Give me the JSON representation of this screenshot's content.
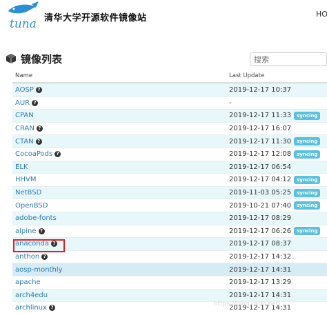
{
  "header": {
    "site_title": "清华大学开源软件镜像站",
    "right_text": "HOM"
  },
  "section": {
    "title": "镜像列表",
    "icon": "cube-icon"
  },
  "search": {
    "placeholder": "搜索"
  },
  "table": {
    "columns": [
      "Name",
      "Last Update"
    ],
    "rows": [
      {
        "name": "AOSP",
        "help": true,
        "date": "2019-12-17 10:37",
        "status": ""
      },
      {
        "name": "AUR",
        "help": true,
        "date": "-",
        "status": ""
      },
      {
        "name": "CPAN",
        "help": false,
        "date": "2019-12-17 11:33",
        "status": "syncing"
      },
      {
        "name": "CRAN",
        "help": true,
        "date": "2019-12-17 16:07",
        "status": ""
      },
      {
        "name": "CTAN",
        "help": true,
        "date": "2019-12-17 11:30",
        "status": "syncing"
      },
      {
        "name": "CocoaPods",
        "help": true,
        "date": "2019-12-17 12:08",
        "status": "syncing"
      },
      {
        "name": "ELK",
        "help": false,
        "date": "2019-12-17 06:54",
        "status": ""
      },
      {
        "name": "HHVM",
        "help": false,
        "date": "2019-12-17 04:12",
        "status": "syncing"
      },
      {
        "name": "NetBSD",
        "help": false,
        "date": "2019-11-03 05:25",
        "status": "syncing"
      },
      {
        "name": "OpenBSD",
        "help": false,
        "date": "2019-10-21 07:40",
        "status": "syncing"
      },
      {
        "name": "adobe-fonts",
        "help": false,
        "date": "2019-12-17 08:29",
        "status": ""
      },
      {
        "name": "alpine",
        "help": true,
        "date": "2019-12-17 06:26",
        "status": "syncing"
      },
      {
        "name": "anaconda",
        "help": true,
        "date": "2019-12-17 08:37",
        "status": ""
      },
      {
        "name": "anthon",
        "help": true,
        "date": "2019-12-17 14:32",
        "status": ""
      },
      {
        "name": "aosp-monthly",
        "help": false,
        "date": "2019-12-17 14:31",
        "status": ""
      },
      {
        "name": "apache",
        "help": false,
        "date": "2019-12-17 13:29",
        "status": ""
      },
      {
        "name": "arch4edu",
        "help": false,
        "date": "2019-12-17 14:31",
        "status": ""
      },
      {
        "name": "archlinux",
        "help": true,
        "date": "2019-12-17 14:31",
        "status": ""
      }
    ]
  },
  "watermark": "https://blog.csdn.net/..."
}
